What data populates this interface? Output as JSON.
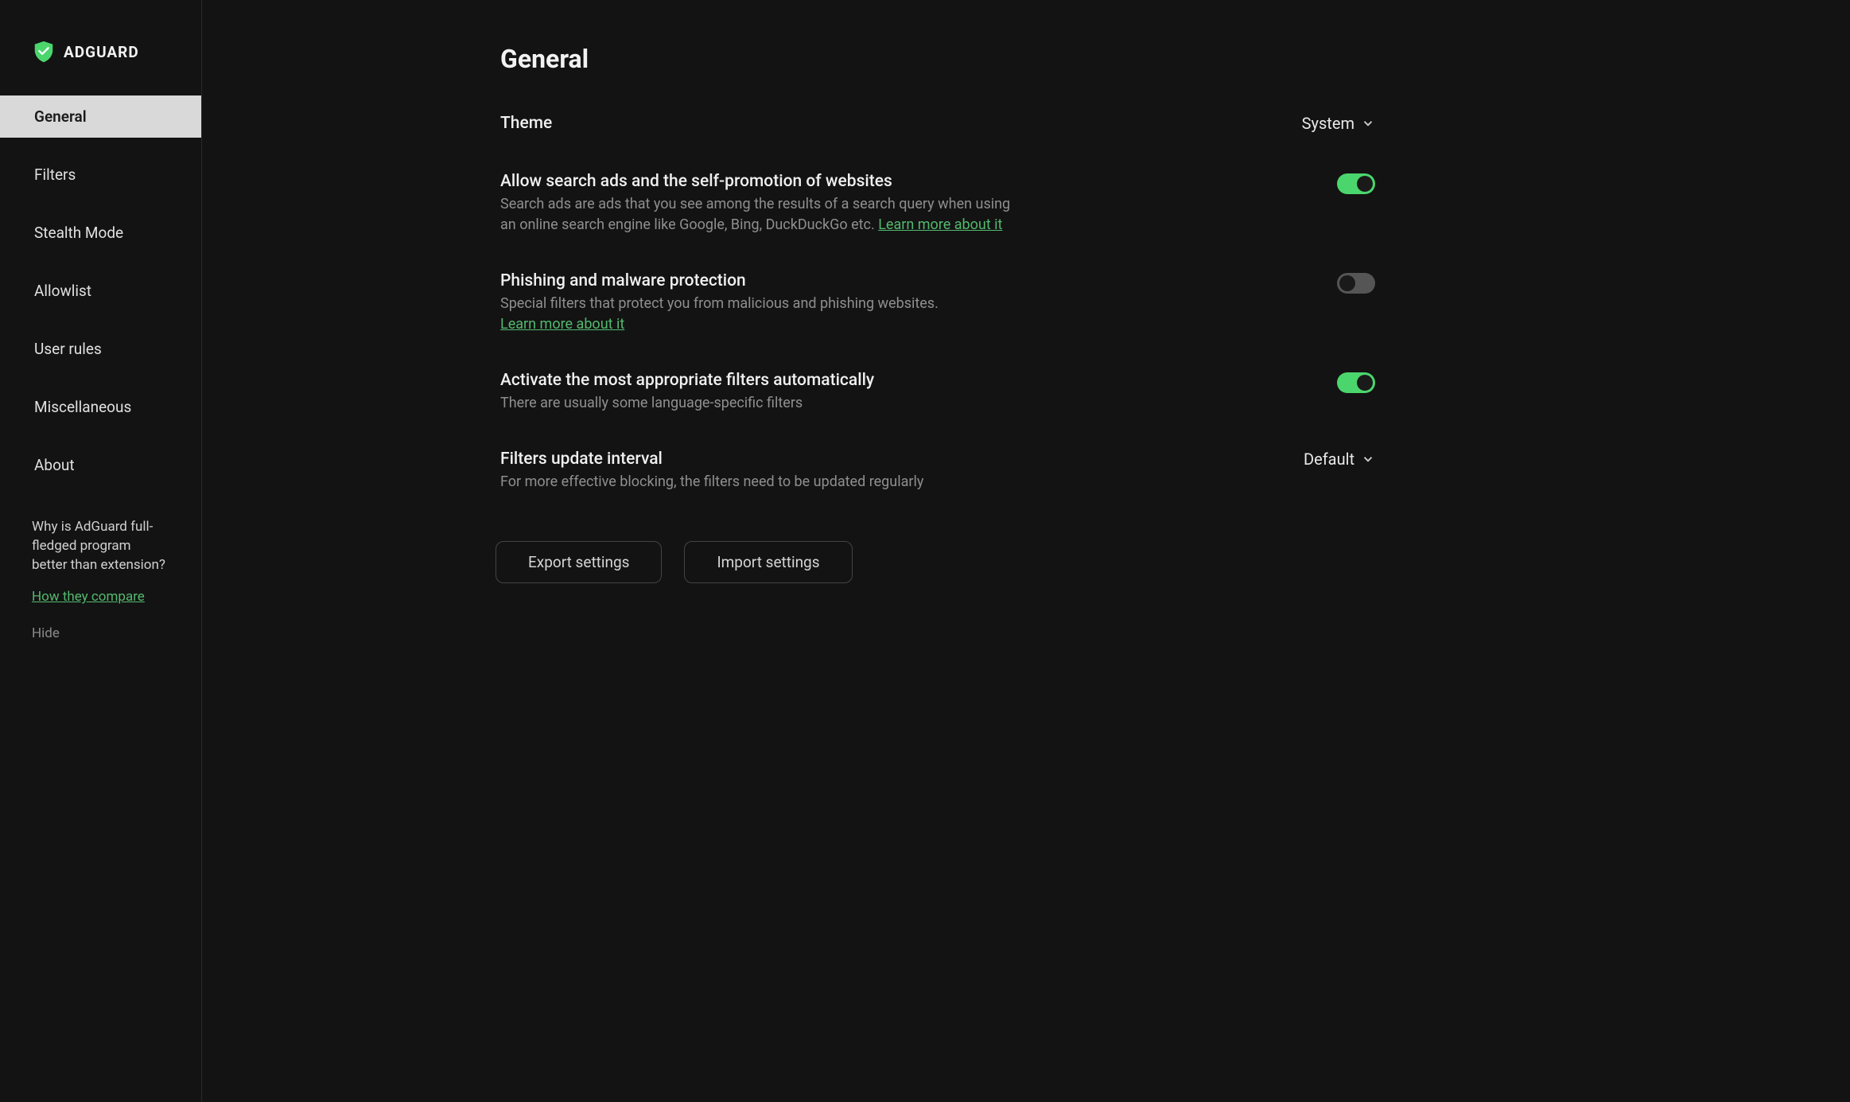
{
  "app": {
    "brand": "ADGUARD"
  },
  "sidebar": {
    "items": [
      {
        "label": "General",
        "active": true
      },
      {
        "label": "Filters",
        "active": false
      },
      {
        "label": "Stealth Mode",
        "active": false
      },
      {
        "label": "Allowlist",
        "active": false
      },
      {
        "label": "User rules",
        "active": false
      },
      {
        "label": "Miscellaneous",
        "active": false
      },
      {
        "label": "About",
        "active": false
      }
    ],
    "promo_text": "Why is AdGuard full-fledged program better than extension?",
    "compare_link": "How they compare",
    "hide_label": "Hide"
  },
  "main": {
    "title": "General",
    "theme": {
      "label": "Theme",
      "value": "System"
    },
    "search_ads": {
      "title": "Allow search ads and the self-promotion of websites",
      "desc": "Search ads are ads that you see among the results of a search query when using an online search engine like Google, Bing, DuckDuckGo etc. ",
      "link": "Learn more about it",
      "enabled": true
    },
    "phishing": {
      "title": "Phishing and malware protection",
      "desc": "Special filters that protect you from malicious and phishing websites. ",
      "link": "Learn more about it",
      "enabled": false
    },
    "auto_filters": {
      "title": "Activate the most appropriate filters automatically",
      "desc": "There are usually some language-specific filters",
      "enabled": true
    },
    "update_interval": {
      "title": "Filters update interval",
      "desc": "For more effective blocking, the filters need to be updated regularly",
      "value": "Default"
    },
    "buttons": {
      "export": "Export settings",
      "import": "Import settings"
    }
  }
}
